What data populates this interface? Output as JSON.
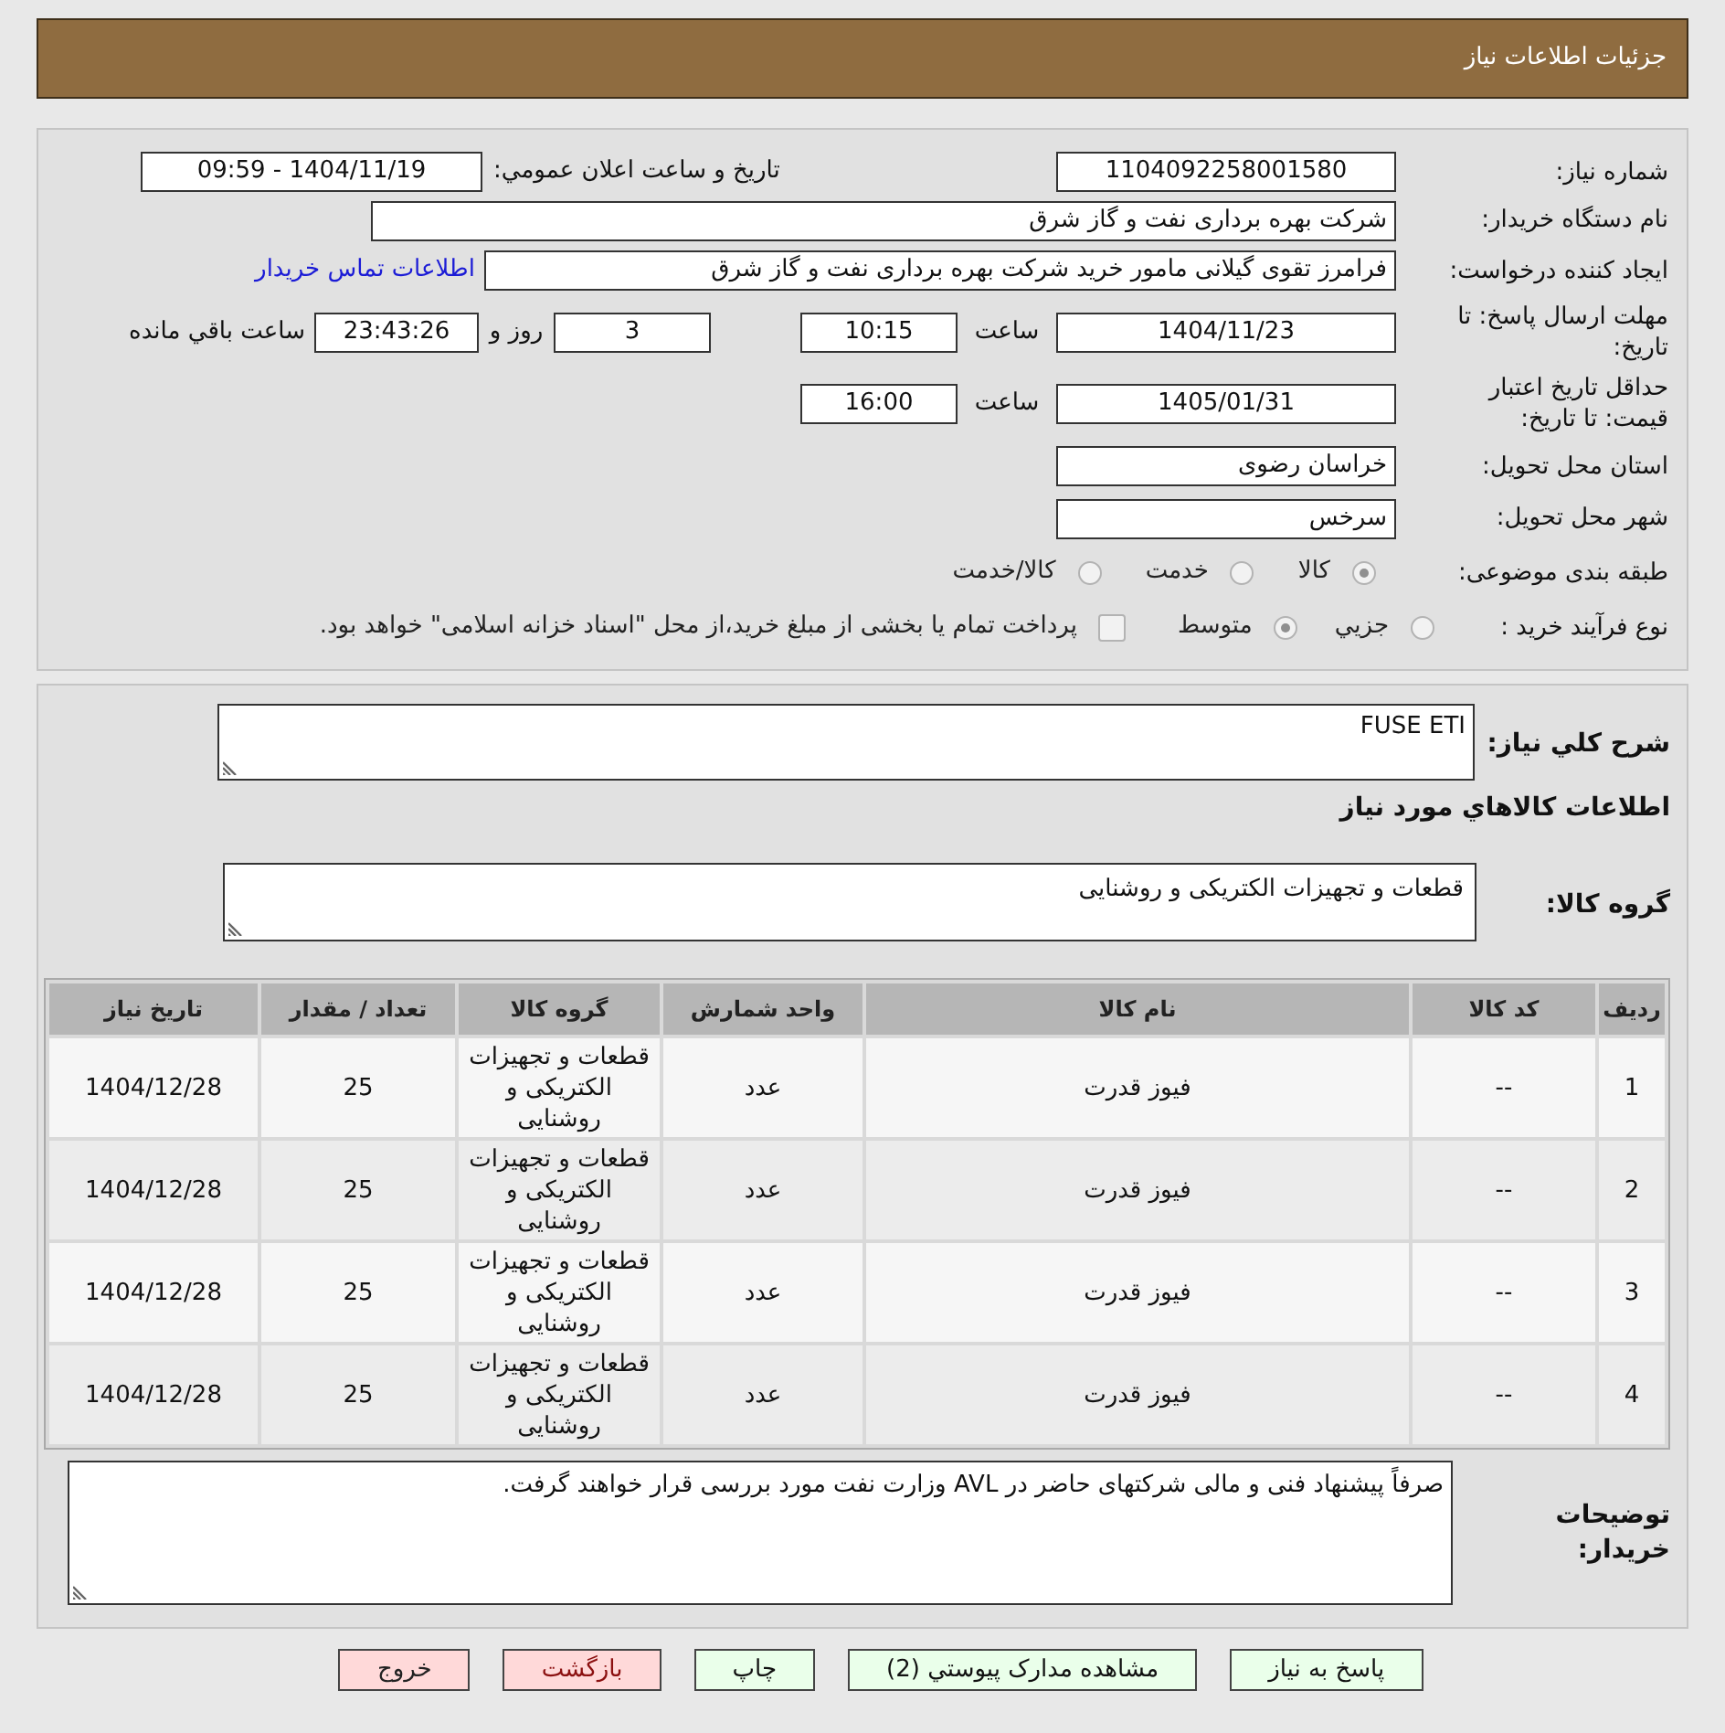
{
  "header": {
    "title": "جزئیات اطلاعات نیاز"
  },
  "details": {
    "need_number": {
      "label": "شماره نیاز:",
      "value": "1104092258001580"
    },
    "announce_datetime": {
      "label": "تاریخ و ساعت اعلان عمومي:",
      "value": "1404/11/19 - 09:59"
    },
    "buyer_org": {
      "label": "نام دستگاه خریدار:",
      "value": "شرکت بهره برداری نفت و گاز شرق"
    },
    "requester": {
      "label": "ایجاد کننده درخواست:",
      "value": "فرامرز تقوی گیلانی مامور خرید شرکت بهره برداری نفت و گاز شرق",
      "link": "اطلاعات تماس خریدار"
    },
    "response_deadline": {
      "label": "مهلت ارسال پاسخ: تا تاریخ:",
      "date": "1404/11/23",
      "time_label": "ساعت",
      "time": "10:15",
      "days": "3",
      "days_label": "روز و",
      "remaining": "23:43:26",
      "remaining_label": "ساعت باقي مانده"
    },
    "price_validity": {
      "label": "حداقل تاریخ اعتبار قیمت: تا تاریخ:",
      "date": "1405/01/31",
      "time_label": "ساعت",
      "time": "16:00"
    },
    "province": {
      "label": "استان محل تحویل:",
      "value": "خراسان رضوی"
    },
    "city": {
      "label": "شهر محل تحویل:",
      "value": "سرخس"
    },
    "category": {
      "label": "طبقه بندی موضوعی:",
      "options": [
        {
          "label": "کالا",
          "selected": true
        },
        {
          "label": "خدمت",
          "selected": false
        },
        {
          "label": "کالا/خدمت",
          "selected": false
        }
      ]
    },
    "purchase_process": {
      "label": "نوع فرآیند خرید :",
      "options": [
        {
          "label": "جزيي",
          "selected": false
        },
        {
          "label": "متوسط",
          "selected": true
        }
      ],
      "treasury": {
        "label": "پرداخت تمام یا بخشی از مبلغ خرید،از محل \"اسناد خزانه اسلامی\" خواهد بود.",
        "checked": false
      }
    }
  },
  "description": {
    "label": "شرح كلي نياز:",
    "value": "FUSE ETI"
  },
  "items_title": "اطلاعات كالاهاي مورد نياز",
  "goods_group": {
    "label": "گروه کالا:",
    "value": "قطعات و تجهیزات الکتریکی و روشنایی"
  },
  "table": {
    "columns": [
      "ردیف",
      "کد کالا",
      "نام کالا",
      "واحد شمارش",
      "گروه کالا",
      "تعداد / مقدار",
      "تاریخ نیاز"
    ],
    "rows": [
      [
        "1",
        "--",
        "فیوز قدرت",
        "عدد",
        "قطعات و تجهیزات الکتریکی و روشنایی",
        "25",
        "1404/12/28"
      ],
      [
        "2",
        "--",
        "فیوز قدرت",
        "عدد",
        "قطعات و تجهیزات الکتریکی و روشنایی",
        "25",
        "1404/12/28"
      ],
      [
        "3",
        "--",
        "فیوز قدرت",
        "عدد",
        "قطعات و تجهیزات الکتریکی و روشنایی",
        "25",
        "1404/12/28"
      ],
      [
        "4",
        "--",
        "فیوز قدرت",
        "عدد",
        "قطعات و تجهیزات الکتریکی و روشنایی",
        "25",
        "1404/12/28"
      ]
    ]
  },
  "buyer_notes": {
    "label": "توضیحات خریدار:",
    "value": "صرفاً پیشنهاد فنی و مالی شرکتهای حاضر در AVL وزارت نفت مورد بررسی قرار خواهند گرفت."
  },
  "buttons": [
    {
      "label": "پاسخ به نیاز",
      "kind": "action"
    },
    {
      "label": "مشاهده مدارک پیوستي (2)",
      "kind": "action"
    },
    {
      "label": "چاپ",
      "kind": "action"
    },
    {
      "label": "بازگشت",
      "kind": "back"
    },
    {
      "label": "خروج",
      "kind": "exit"
    }
  ]
}
